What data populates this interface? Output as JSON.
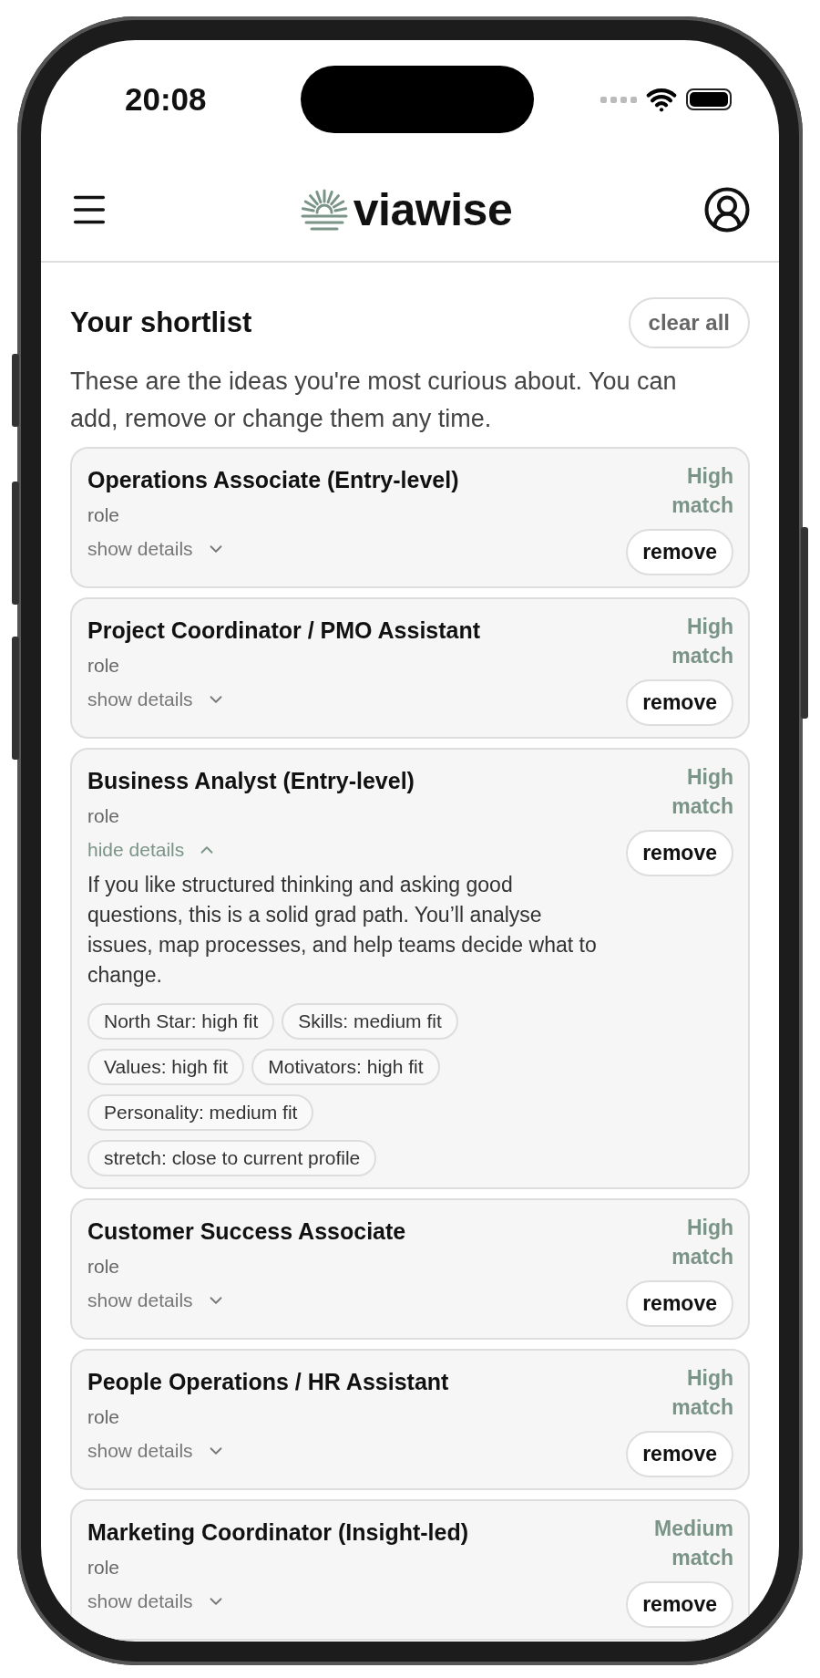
{
  "status_bar": {
    "time": "20:08"
  },
  "header": {
    "logo": "viawise"
  },
  "shortlist": {
    "title": "Your shortlist",
    "clear_button": "clear all",
    "intro": "These are the ideas you're most curious about. You can add, remove or change them any time."
  },
  "items": [
    {
      "title": "Operations Associate (Entry-level)",
      "type": "role",
      "match": "High match",
      "toggle": "show details",
      "expanded": false,
      "remove": "remove"
    },
    {
      "title": "Project Coordinator / PMO Assistant",
      "type": "role",
      "match": "High match",
      "toggle": "show details",
      "expanded": false,
      "remove": "remove"
    },
    {
      "title": "Business Analyst (Entry-level)",
      "type": "role",
      "match": "High match",
      "toggle": "hide details",
      "expanded": true,
      "remove": "remove",
      "description": "If you like structured thinking and asking good questions, this is a solid grad path. You’ll analyse issues, map processes, and help teams decide what to change.",
      "tags": [
        "North Star: high fit",
        "Skills: medium fit",
        "Values: high fit",
        "Motivators: high fit",
        "Personality: medium fit",
        "stretch: close to current profile"
      ]
    },
    {
      "title": "Customer Success Associate",
      "type": "role",
      "match": "High match",
      "toggle": "show details",
      "expanded": false,
      "remove": "remove"
    },
    {
      "title": "People Operations / HR Assistant",
      "type": "role",
      "match": "High match",
      "toggle": "show details",
      "expanded": false,
      "remove": "remove"
    },
    {
      "title": "Marketing Coordinator (Insight-led)",
      "type": "role",
      "match": "Medium match",
      "toggle": "show details",
      "expanded": false,
      "remove": "remove"
    }
  ]
}
